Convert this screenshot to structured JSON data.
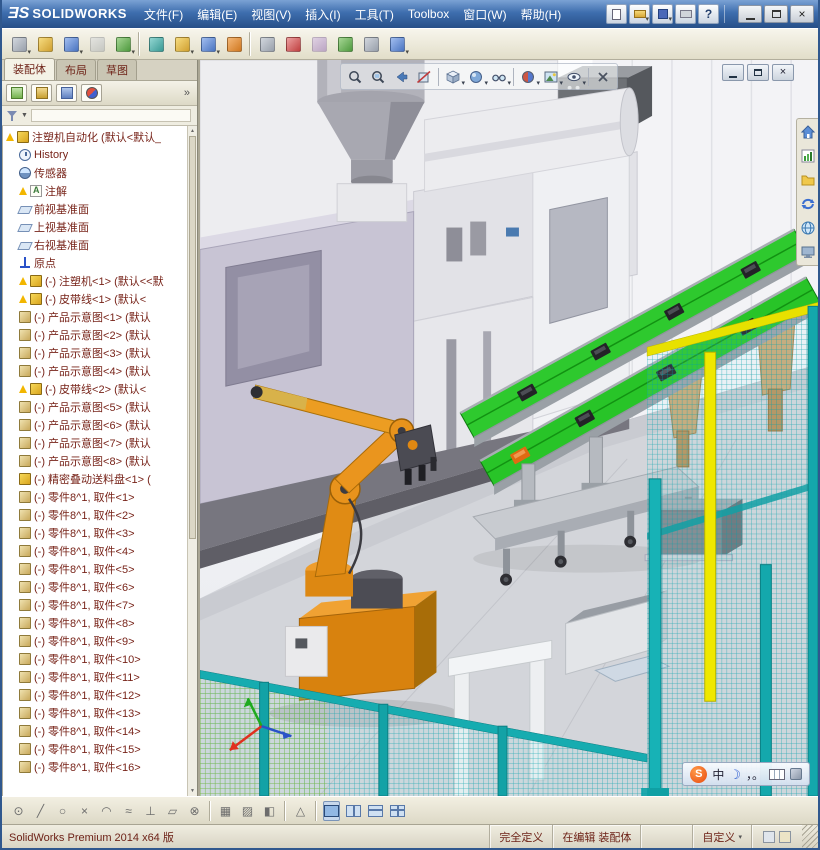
{
  "titlebar": {
    "logo_prefix": "ƎS",
    "logo_text": "SOLIDWORKS",
    "menus": [
      "文件(F)",
      "编辑(E)",
      "视图(V)",
      "插入(I)",
      "工具(T)",
      "Toolbox",
      "窗口(W)",
      "帮助(H)"
    ],
    "quick_icons": [
      {
        "name": "new-document-icon",
        "cls": "q-new"
      },
      {
        "name": "open-document-icon",
        "cls": "q-open",
        "dd": true
      },
      {
        "name": "save-icon",
        "cls": "q-save",
        "dd": true
      },
      {
        "name": "print-icon",
        "cls": "q-print"
      },
      {
        "name": "help-icon",
        "cls": "q-help",
        "glyph": "?"
      }
    ]
  },
  "toolbar": {
    "items": [
      {
        "name": "insert-components-icon",
        "tone": "tn-grey",
        "dd": true
      },
      {
        "name": "mate-icon",
        "tone": "tn-yellow"
      },
      {
        "name": "linear-component-pattern-icon",
        "tone": "tn-blue",
        "dd": true
      },
      {
        "name": "smart-fasteners-icon",
        "tone": "tn-grey",
        "dis": true
      },
      {
        "name": "move-component-icon",
        "tone": "tn-green",
        "dd": true
      },
      {
        "name": "toolbar-separator",
        "sep": true
      },
      {
        "name": "show-hidden-components-icon",
        "tone": "tn-teal"
      },
      {
        "name": "assembly-features-icon",
        "tone": "tn-yellow",
        "dd": true
      },
      {
        "name": "reference-geometry-icon",
        "tone": "tn-blue",
        "dd": true
      },
      {
        "name": "new-motion-study-icon",
        "tone": "tn-orange"
      },
      {
        "name": "toolbar-separator",
        "sep": true
      },
      {
        "name": "bill-of-materials-icon",
        "tone": "tn-grey"
      },
      {
        "name": "exploded-view-icon",
        "tone": "tn-red"
      },
      {
        "name": "explode-line-sketch-icon",
        "tone": "tn-purple",
        "dis": true
      },
      {
        "name": "interference-detection-icon",
        "tone": "tn-green"
      },
      {
        "name": "clearance-verification-icon",
        "tone": "tn-grey"
      },
      {
        "name": "assembly-visualization-icon",
        "tone": "tn-blue",
        "dd": true
      }
    ]
  },
  "command_tabs": [
    {
      "label": "装配体",
      "active": true
    },
    {
      "label": "布局",
      "active": false
    },
    {
      "label": "草图",
      "active": false
    }
  ],
  "panel": {
    "tabs": [
      {
        "name": "featuremanager-tab-icon",
        "cls": "pm1"
      },
      {
        "name": "propertymanager-tab-icon",
        "cls": "pm2"
      },
      {
        "name": "configurationmanager-tab-icon",
        "cls": "pm3"
      },
      {
        "name": "displaymanager-tab-icon",
        "cls": "pm4"
      }
    ],
    "overflow": "»",
    "filter_caret": "▼"
  },
  "feature_tree": {
    "items": [
      {
        "text": "注塑机自动化 (默认<默认_",
        "icon": "assembly",
        "warn": true
      },
      {
        "text": "History",
        "icon": "history",
        "ind": true
      },
      {
        "text": "传感器",
        "icon": "sensor",
        "ind": true
      },
      {
        "text": "注解",
        "icon": "ann",
        "warn": true,
        "ind": true
      },
      {
        "text": "前视基准面",
        "icon": "plane",
        "ind": true
      },
      {
        "text": "上视基准面",
        "icon": "plane",
        "ind": true
      },
      {
        "text": "右视基准面",
        "icon": "plane",
        "ind": true
      },
      {
        "text": "原点",
        "icon": "origin",
        "ind": true
      },
      {
        "text": "(-) 注塑机<1> (默认<<默",
        "icon": "assembly",
        "warn": true,
        "ind": true
      },
      {
        "text": "(-) 皮带线<1> (默认<",
        "icon": "assembly",
        "warn": true,
        "ind": true
      },
      {
        "text": "(-) 产品示意图<1> (默认",
        "icon": "part",
        "ind": true
      },
      {
        "text": "(-) 产品示意图<2> (默认",
        "icon": "part",
        "ind": true
      },
      {
        "text": "(-) 产品示意图<3> (默认",
        "icon": "part",
        "ind": true
      },
      {
        "text": "(-) 产品示意图<4> (默认",
        "icon": "part",
        "ind": true
      },
      {
        "text": "(-) 皮带线<2> (默认<",
        "icon": "assembly",
        "warn": true,
        "ind": true
      },
      {
        "text": "(-) 产品示意图<5> (默认",
        "icon": "part",
        "ind": true
      },
      {
        "text": "(-) 产品示意图<6> (默认",
        "icon": "part",
        "ind": true
      },
      {
        "text": "(-) 产品示意图<7> (默认",
        "icon": "part",
        "ind": true
      },
      {
        "text": "(-) 产品示意图<8> (默认",
        "icon": "part",
        "ind": true
      },
      {
        "text": "(-) 精密叠动送料盘<1> (",
        "icon": "assembly",
        "ind": true
      },
      {
        "text": "(-) 零件8^1, 取件<1>",
        "icon": "part",
        "ind": true
      },
      {
        "text": "(-) 零件8^1, 取件<2>",
        "icon": "part",
        "ind": true
      },
      {
        "text": "(-) 零件8^1, 取件<3>",
        "icon": "part",
        "ind": true
      },
      {
        "text": "(-) 零件8^1, 取件<4>",
        "icon": "part",
        "ind": true
      },
      {
        "text": "(-) 零件8^1, 取件<5>",
        "icon": "part",
        "ind": true
      },
      {
        "text": "(-) 零件8^1, 取件<6>",
        "icon": "part",
        "ind": true
      },
      {
        "text": "(-) 零件8^1, 取件<7>",
        "icon": "part",
        "ind": true
      },
      {
        "text": "(-) 零件8^1, 取件<8>",
        "icon": "part",
        "ind": true
      },
      {
        "text": "(-) 零件8^1, 取件<9>",
        "icon": "part",
        "ind": true
      },
      {
        "text": "(-) 零件8^1, 取件<10>",
        "icon": "part",
        "ind": true
      },
      {
        "text": "(-) 零件8^1, 取件<11>",
        "icon": "part",
        "ind": true
      },
      {
        "text": "(-) 零件8^1, 取件<12>",
        "icon": "part",
        "ind": true
      },
      {
        "text": "(-) 零件8^1, 取件<13>",
        "icon": "part",
        "ind": true
      },
      {
        "text": "(-) 零件8^1, 取件<14>",
        "icon": "part",
        "ind": true
      },
      {
        "text": "(-) 零件8^1, 取件<15>",
        "icon": "part",
        "ind": true
      },
      {
        "text": "(-) 零件8^1, 取件<16>",
        "icon": "part",
        "ind": true
      }
    ]
  },
  "viewport": {
    "hud_icons": [
      "zoom-fit-icon",
      "zoom-area-icon",
      "previous-view-icon",
      "section-view-icon",
      "view-orientation-icon",
      "display-style-icon",
      "hide-show-items-icon",
      "edit-appearance-icon",
      "apply-scene-icon",
      "view-settings-icon",
      "close-popup-icon"
    ],
    "taskpane_icons": [
      "home-icon",
      "design-library-icon",
      "file-explorer-icon",
      "forum-icon",
      "appearances-icon",
      "custom-properties-icon"
    ],
    "ime": {
      "sogou": "S",
      "lang": "中",
      "moon": "☽",
      "punct": "，。"
    }
  },
  "bottom_toolbar": {
    "items": [
      {
        "name": "snap-points-icon",
        "glyph": "⊙"
      },
      {
        "name": "snap-line-icon",
        "glyph": "╱"
      },
      {
        "name": "snap-circle-icon",
        "glyph": "○"
      },
      {
        "name": "snap-intersection-icon",
        "glyph": "×"
      },
      {
        "name": "snap-arc-icon",
        "glyph": "◠"
      },
      {
        "name": "snap-tangent-icon",
        "glyph": "≈"
      },
      {
        "name": "snap-perpendicular-icon",
        "glyph": "⊥"
      },
      {
        "name": "snap-parallel-icon",
        "glyph": "▱"
      },
      {
        "name": "snap-quadrant-icon",
        "glyph": "⊗"
      },
      {
        "name": "toolbar-separator",
        "sep": true
      },
      {
        "name": "grid-settings-icon",
        "glyph": "▦"
      },
      {
        "name": "hatch-icon",
        "glyph": "▨"
      },
      {
        "name": "shaded-sketch-icon",
        "glyph": "◧"
      },
      {
        "name": "toolbar-separator",
        "sep": true
      },
      {
        "name": "draft-quality-icon",
        "glyph": "△"
      },
      {
        "name": "toolbar-separator",
        "sep": true
      },
      {
        "name": "single-view-icon",
        "cls": "vpbox vp1",
        "active": true
      },
      {
        "name": "two-view-horizontal-icon",
        "cls": "vpbox vp2"
      },
      {
        "name": "two-view-vertical-icon",
        "cls": "vpbox vp2v"
      },
      {
        "name": "four-view-icon",
        "cls": "vpbox vp4"
      }
    ]
  },
  "statusbar": {
    "product": "SolidWorks Premium 2014 x64 版",
    "defined": "完全定义",
    "editing": "在编辑 装配体",
    "custom": "自定义"
  },
  "scene_colors": {
    "belt_green": "#2ec92e",
    "robot_orange": "#e08b14",
    "fence_teal": "#14a8ac",
    "frame_yellow": "#efe800",
    "machine_panel": "#c8c4d4"
  }
}
